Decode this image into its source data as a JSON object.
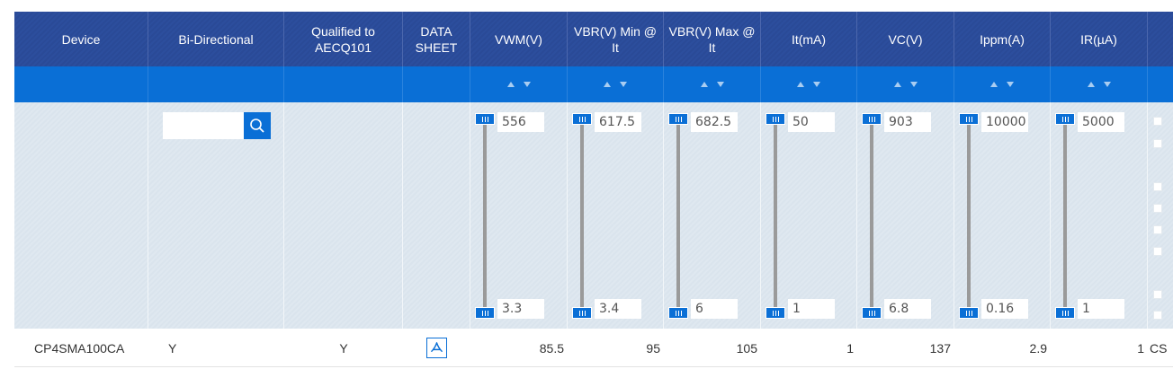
{
  "headers": [
    "Device",
    "Bi-Directional",
    "Qualified to AECQ101",
    "DATA SHEET",
    "VWM(V)",
    "VBR(V) Min @ It",
    "VBR(V) Max @ It",
    "It(mA)",
    "VC(V)",
    "Ippm(A)",
    "IR(µA)"
  ],
  "search": {
    "value": "",
    "icon": "search-icon"
  },
  "ranges": [
    {
      "max": "556",
      "min": "3.3"
    },
    {
      "max": "617.5",
      "min": "3.4"
    },
    {
      "max": "682.5",
      "min": "6"
    },
    {
      "max": "50",
      "min": "1"
    },
    {
      "max": "903",
      "min": "6.8"
    },
    {
      "max": "10000",
      "min": "0.16"
    },
    {
      "max": "5000",
      "min": "1"
    }
  ],
  "row": {
    "device": "CP4SMA100CA",
    "bidirectional": "Y",
    "qualified": "Y",
    "datasheet_icon": "pdf-icon",
    "vwm": "85.5",
    "vbr_min": "95",
    "vbr_max": "105",
    "it": "1",
    "vc": "137",
    "ippm": "2.9",
    "ir": "1",
    "extra": "CS"
  },
  "colors": {
    "header": "#2c4e9d",
    "accent": "#0a6fd6",
    "filter_bg": "#dde6ee"
  }
}
